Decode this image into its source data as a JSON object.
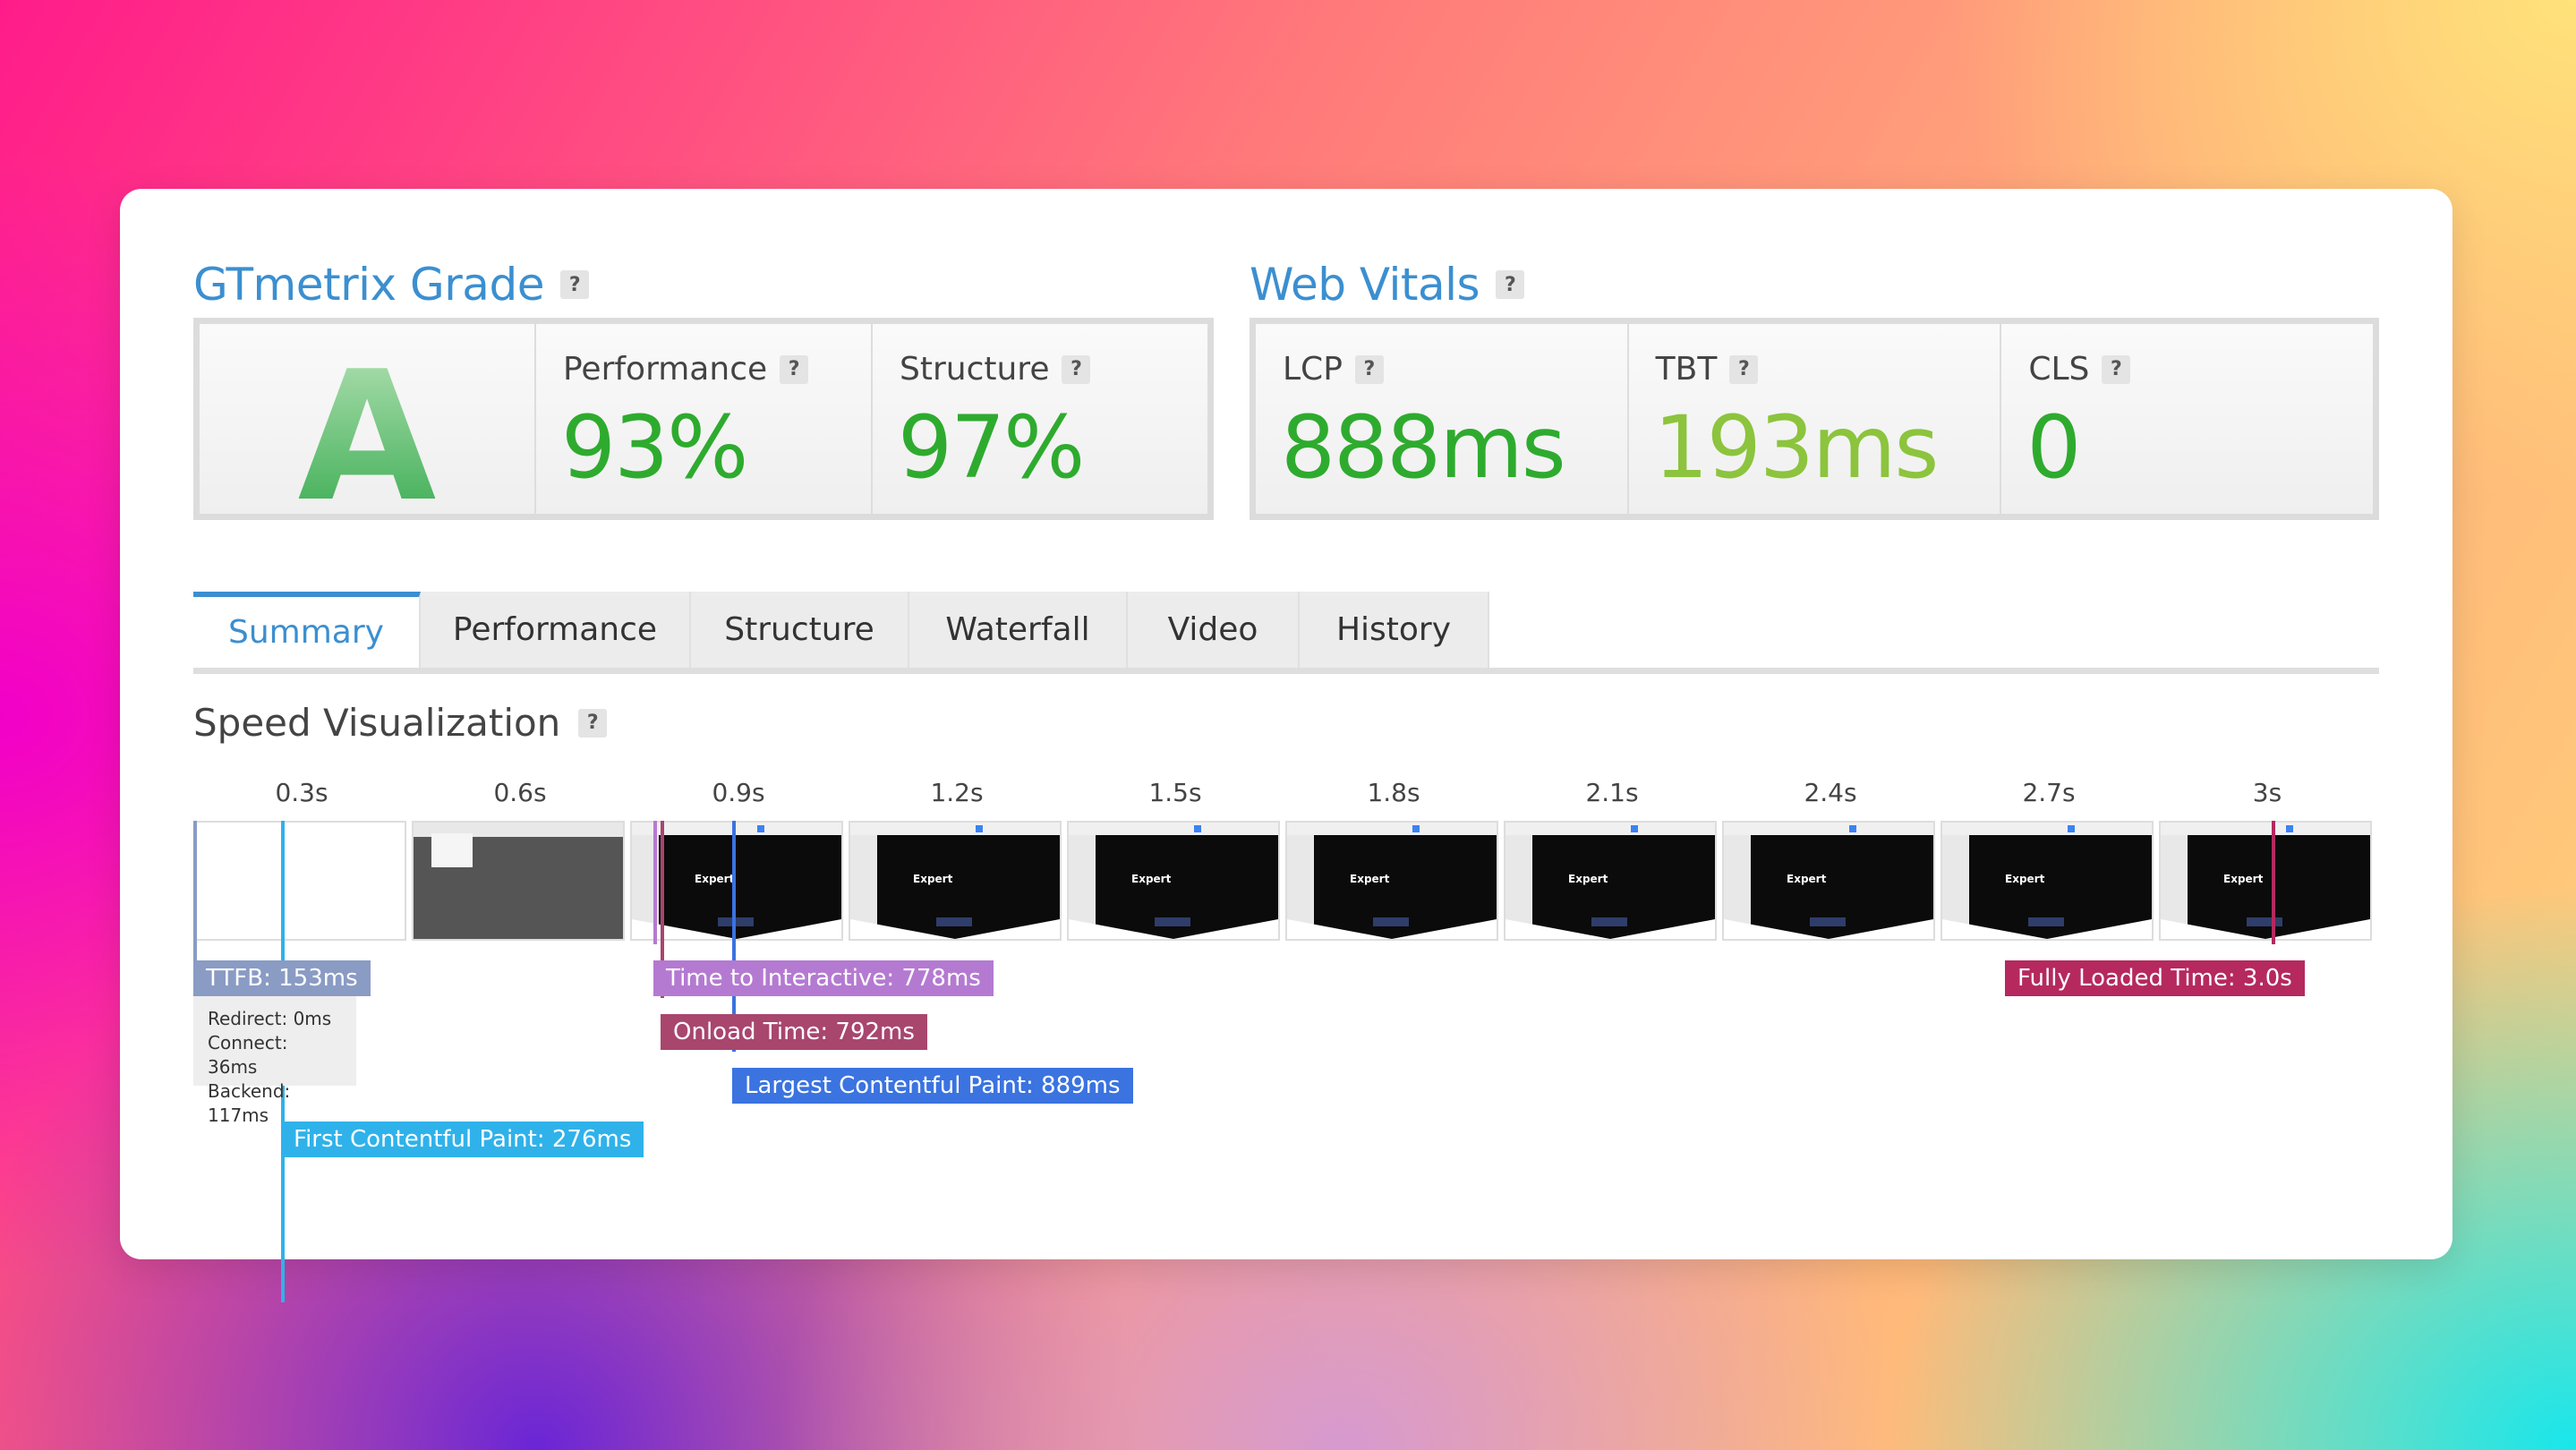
{
  "grade": {
    "title": "GTmetrix Grade",
    "letter": "A",
    "performance": {
      "label": "Performance",
      "value": "93%"
    },
    "structure": {
      "label": "Structure",
      "value": "97%"
    }
  },
  "vitals": {
    "title": "Web Vitals",
    "lcp": {
      "label": "LCP",
      "value": "888ms"
    },
    "tbt": {
      "label": "TBT",
      "value": "193ms"
    },
    "cls": {
      "label": "CLS",
      "value": "0"
    }
  },
  "help_mark": "?",
  "tabs": [
    "Summary",
    "Performance",
    "Structure",
    "Waterfall",
    "Video",
    "History"
  ],
  "active_tab": "Summary",
  "speed": {
    "title": "Speed Visualization",
    "times": [
      "0.3s",
      "0.6s",
      "0.9s",
      "1.2s",
      "1.5s",
      "1.8s",
      "2.1s",
      "2.4s",
      "2.7s",
      "3s"
    ],
    "frame_text": "Expert",
    "ttfb": {
      "label": "TTFB: 153ms",
      "redirect": "Redirect: 0ms",
      "connect": "Connect: 36ms",
      "backend": "Backend: 117ms"
    },
    "tti": "Time to Interactive: 778ms",
    "onload": "Onload Time: 792ms",
    "lcp": "Largest Contentful Paint: 889ms",
    "fcp": "First Contentful Paint: 276ms",
    "fully_loaded": "Fully Loaded Time: 3.0s"
  },
  "colors": {
    "accent": "#3b8fd0",
    "green": "#2eab2e",
    "light_green": "#8cc43d",
    "ttfb": "#8a9bc4",
    "fcp": "#2fb2ea",
    "tti": "#b47ad1",
    "onload": "#a8466e",
    "lcp": "#3b73e0",
    "fully_loaded": "#b5295e"
  }
}
